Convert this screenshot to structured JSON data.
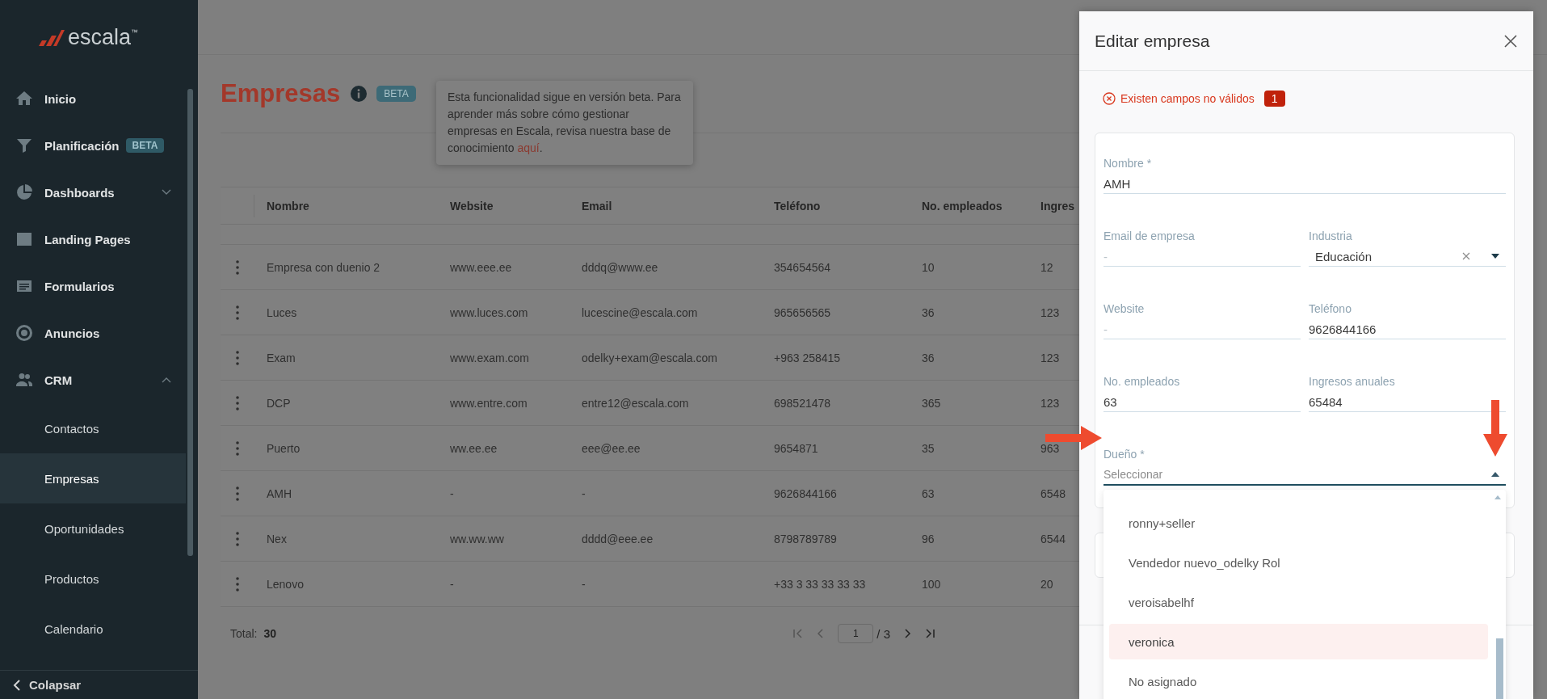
{
  "sidebar": {
    "logo": "escala$^{™}$",
    "items": [
      {
        "label": "Inicio",
        "selected": false
      },
      {
        "label": "Planificación",
        "badge": "BETA",
        "selected": false
      },
      {
        "label": "Dashboards",
        "expanded": false,
        "selected": false
      },
      {
        "label": "Landing Pages",
        "selected": false
      },
      {
        "label": "Formularios",
        "selected": false
      },
      {
        "label": "Anuncios",
        "selected": false
      },
      {
        "label": "CRM",
        "expanded": true,
        "selected": false,
        "children": [
          {
            "label": "Contactos",
            "selected": false
          },
          {
            "label": "Empresas",
            "selected": true
          },
          {
            "label": "Oportunidades",
            "selected": false
          },
          {
            "label": "Productos",
            "selected": false
          },
          {
            "label": "Calendario",
            "selected": false
          }
        ]
      }
    ],
    "collapse": "Colapsar"
  },
  "page": {
    "title": "Empresas",
    "badge": "BETA",
    "tooltip": {
      "text": "Esta funcionalidad sigue en versión beta. Para aprender más sobre cómo gestionar empresas en Escala, revisa nuestra base de conocimiento",
      "link": "aquí",
      "end": "."
    },
    "table": {
      "columns": [
        "Nombre",
        "Website",
        "Email",
        "Teléfono",
        "No. empleados",
        "Ingres"
      ],
      "rows": [
        [
          "Empresa con duenio 2",
          "www.eee.ee",
          "dddq@www.ee",
          "354654564",
          "10",
          "12"
        ],
        [
          "Luces",
          "www.luces.com",
          "lucescine@escala.com",
          "965656565",
          "36",
          "123"
        ],
        [
          "Exam",
          "www.exam.com",
          "odelky+exam@escala.com",
          "+963 258415",
          "36",
          "123"
        ],
        [
          "DCP",
          "www.entre.com",
          "entre12@escala.com",
          "698521478",
          "365",
          "123"
        ],
        [
          "Puerto",
          "ww.ee.ee",
          "eee@ee.ee",
          "9654871",
          "35",
          "963"
        ],
        [
          "AMH",
          "-",
          "-",
          "9626844166",
          "63",
          "6548"
        ],
        [
          "Nex",
          "ww.ww.ww",
          "dddd@eee.ee",
          "8798789789",
          "96",
          "6544"
        ],
        [
          "Lenovo",
          "-",
          "-",
          "+33 3 33 33 33 33",
          "100",
          "20"
        ]
      ]
    },
    "pagination": {
      "total_label": "Total:",
      "total": "30",
      "page": "1",
      "of": "/ 3"
    }
  },
  "panel": {
    "title": "Editar empresa",
    "error": {
      "text": "Existen campos no válidos",
      "count": "1"
    },
    "rows": [
      [
        {
          "label": "Nombre *",
          "value": "AMH",
          "kind": "text"
        }
      ],
      [
        {
          "label": "Email de empresa",
          "placeholder": "-",
          "kind": "text"
        },
        {
          "label": "Industria",
          "value": "Educación",
          "kind": "select",
          "clearable": true,
          "expanded": false
        }
      ],
      [
        {
          "label": "Website",
          "placeholder": "-",
          "kind": "text"
        },
        {
          "label": "Teléfono",
          "value": "9626844166",
          "kind": "text"
        }
      ],
      [
        {
          "label": "No. empleados",
          "value": "63",
          "kind": "text"
        },
        {
          "label": "Ingresos anuales",
          "value": "65484",
          "kind": "text"
        }
      ],
      [
        {
          "label": "Dueño *",
          "placeholder": "Seleccionar",
          "kind": "select",
          "expanded": true,
          "focused": true,
          "options": [
            {
              "label": "ronny+seller",
              "selected": false
            },
            {
              "label": "Vendedor nuevo_odelky Rol",
              "selected": false
            },
            {
              "label": "veroisabelhf",
              "selected": false
            },
            {
              "label": "veronica",
              "selected": true
            },
            {
              "label": "No asignado",
              "selected": false
            }
          ]
        }
      ]
    ]
  }
}
